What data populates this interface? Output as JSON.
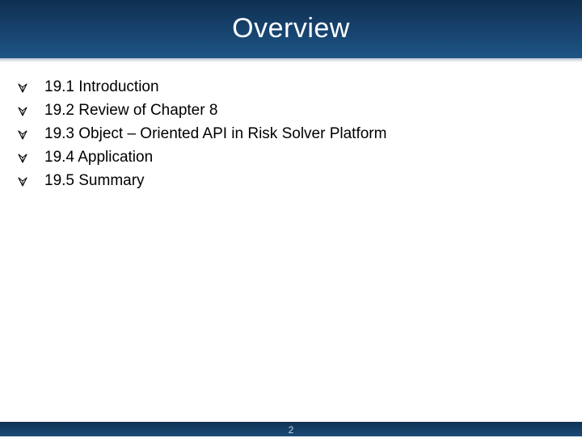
{
  "slide": {
    "title": "Overview",
    "bullets": [
      "19.1 Introduction",
      "19.2 Review of Chapter 8",
      "19.3 Object – Oriented API in Risk Solver Platform",
      "19.4 Application",
      "19.5 Summary"
    ],
    "bullet_icon": "diamond-arrow-bullet-icon",
    "page_number": "2"
  },
  "colors": {
    "header_bar": "#16406a",
    "footer_bar": "#1a4a78",
    "title_text": "#ffffff",
    "body_text": "#000000"
  }
}
